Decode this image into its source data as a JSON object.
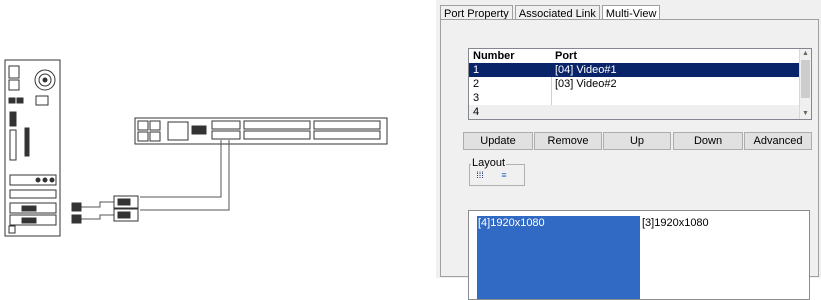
{
  "tabs": [
    "Port Property",
    "Associated Link",
    "Multi-View"
  ],
  "grid": {
    "headers": [
      "Number",
      "Port"
    ],
    "rows": [
      {
        "number": "1",
        "port": "[04] Video#1"
      },
      {
        "number": "2",
        "port": "[03] Video#2"
      },
      {
        "number": "3",
        "port": ""
      },
      {
        "number": "4",
        "port": ""
      }
    ]
  },
  "buttons": {
    "update": "Update",
    "remove": "Remove",
    "up": "Up",
    "down": "Down",
    "advanced": "Advanced"
  },
  "layout": {
    "title": "Layout",
    "icons": [
      "grid-layout-icon",
      "list-layout-icon"
    ]
  },
  "preview": {
    "windows": [
      "[4]1920x1080",
      "[3]1920x1080"
    ]
  },
  "colors": {
    "selection": "#0a246a",
    "preview_active": "#316ac5"
  }
}
